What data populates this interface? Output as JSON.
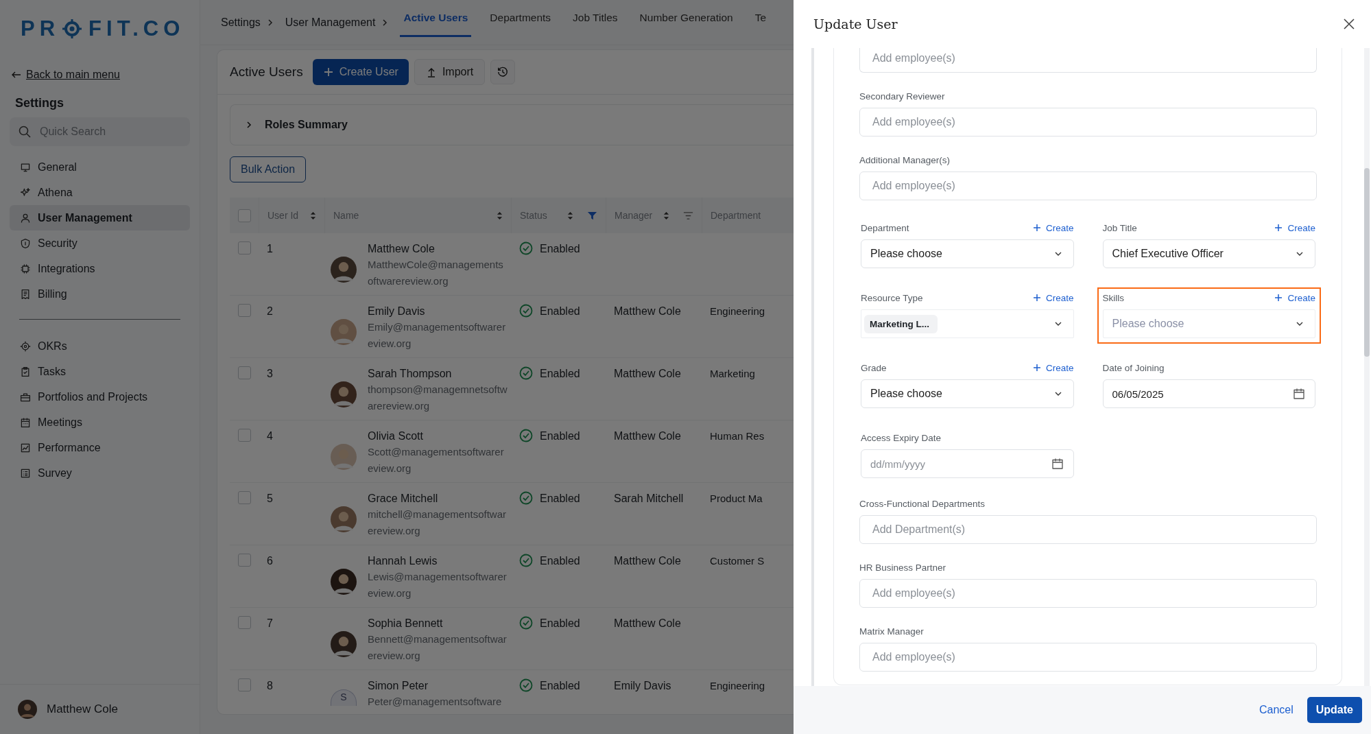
{
  "sidebar": {
    "logo": [
      "PR",
      "FIT.CO"
    ],
    "back_link": "Back to main menu",
    "heading": "Settings",
    "search": {
      "placeholder": "Quick Search"
    },
    "groups": [
      {
        "items": [
          {
            "label": "General",
            "selected": false
          },
          {
            "label": "Athena",
            "selected": false
          },
          {
            "label": "User Management",
            "selected": true
          },
          {
            "label": "Security",
            "selected": false
          },
          {
            "label": "Integrations",
            "selected": false
          },
          {
            "label": "Billing",
            "selected": false
          }
        ]
      },
      {
        "items": [
          {
            "label": "OKRs",
            "selected": false
          },
          {
            "label": "Tasks",
            "selected": false
          },
          {
            "label": "Portfolios and Projects",
            "selected": false
          },
          {
            "label": "Meetings",
            "selected": false
          },
          {
            "label": "Performance",
            "selected": false
          },
          {
            "label": "Survey",
            "selected": false
          }
        ]
      }
    ],
    "user": {
      "name": "Matthew Cole"
    }
  },
  "breadcrumbs": [
    "Settings",
    "User Management"
  ],
  "tabs": [
    {
      "label": "Active Users",
      "selected": true
    },
    {
      "label": "Departments",
      "selected": false
    },
    {
      "label": "Job Titles",
      "selected": false
    },
    {
      "label": "Number Generation",
      "selected": false
    },
    {
      "label": "Te",
      "selected": false
    }
  ],
  "toolbar": {
    "title": "Active Users",
    "create_button": "Create User",
    "import_button": "Import"
  },
  "roles_summary": {
    "label": "Roles Summary",
    "expanded": false
  },
  "bulk_action": "Bulk Action",
  "table": {
    "header_checked": false,
    "columns": [
      {
        "label": "User Id",
        "sortable": true
      },
      {
        "label": "Name",
        "sortable": true
      },
      {
        "label": "Status",
        "sortable": true,
        "filter_active": true
      },
      {
        "label": "Manager",
        "sortable": true,
        "filter_active": false
      },
      {
        "label": "Department",
        "sortable": false
      }
    ],
    "rows": [
      {
        "checked": false,
        "id": "1",
        "name": "Matthew Cole",
        "email": "MatthewCole@managementsoftwarereview.org",
        "avatar": {
          "kind": "photo"
        },
        "status": "Enabled",
        "manager": "",
        "department": ""
      },
      {
        "checked": false,
        "id": "2",
        "name": "Emily Davis",
        "email": "Emily@managementsoftwarereview.org",
        "avatar": {
          "kind": "photo"
        },
        "status": "Enabled",
        "manager": "Matthew Cole",
        "department": "Engineering"
      },
      {
        "checked": false,
        "id": "3",
        "name": "Sarah Thompson",
        "email": "thompson@managemnetsoftwarereview.org",
        "avatar": {
          "kind": "photo"
        },
        "status": "Enabled",
        "manager": "Matthew Cole",
        "department": "Marketing"
      },
      {
        "checked": false,
        "id": "4",
        "name": "Olivia Scott",
        "email": "Scott@managementsoftwarereview.org",
        "avatar": {
          "kind": "photo"
        },
        "status": "Enabled",
        "manager": "Matthew Cole",
        "department": "Human Res"
      },
      {
        "checked": false,
        "id": "5",
        "name": "Grace Mitchell",
        "email": "mitchell@managementsoftwarereview.org",
        "avatar": {
          "kind": "photo"
        },
        "status": "Enabled",
        "manager": "Sarah Mitchell",
        "department": "Product Ma"
      },
      {
        "checked": false,
        "id": "6",
        "name": "Hannah Lewis",
        "email": "Lewis@managementsoftwarereview.org",
        "avatar": {
          "kind": "photo"
        },
        "status": "Enabled",
        "manager": "Matthew Cole",
        "department": "Customer S"
      },
      {
        "checked": false,
        "id": "7",
        "name": "Sophia Bennett",
        "email": "Bennett@managementsoftwarereview.org",
        "avatar": {
          "kind": "photo"
        },
        "status": "Enabled",
        "manager": "Matthew Cole",
        "department": ""
      },
      {
        "checked": false,
        "id": "8",
        "name": "Simon Peter",
        "email": "Peter@managementsoftware",
        "avatar": {
          "kind": "initial",
          "initial": "S"
        },
        "status": "Enabled",
        "manager": "Emily Davis",
        "department": "Engineering"
      }
    ]
  },
  "panel": {
    "title": "Update User",
    "rows": [
      [
        {
          "kind": "employees",
          "placeholder": "Add employee(s)",
          "partly_hidden": true
        }
      ],
      [
        {
          "kind": "employees",
          "label": "Secondary Reviewer",
          "placeholder": "Add employee(s)"
        }
      ],
      [
        {
          "kind": "employees",
          "label": "Additional Manager(s)",
          "placeholder": "Add employee(s)"
        }
      ],
      [
        {
          "kind": "select",
          "label": "Department",
          "create": "Create",
          "value": "Please choose",
          "highlighted": false
        },
        {
          "kind": "select",
          "label": "Job Title",
          "create": "Create",
          "value": "Chief Executive Officer",
          "highlighted": false
        }
      ],
      [
        {
          "kind": "tag-select",
          "label": "Resource Type",
          "create": "Create",
          "tag": "Marketing L...",
          "highlighted": false
        },
        {
          "kind": "select",
          "label": "Skills",
          "create": "Create",
          "placeholder": "Please choose",
          "highlighted": true
        }
      ],
      [
        {
          "kind": "select",
          "label": "Grade",
          "create": "Create",
          "value": "Please choose",
          "highlighted": false
        },
        {
          "kind": "date",
          "label": "Date of Joining",
          "value": "06/05/2025",
          "highlighted": false
        }
      ],
      [
        {
          "kind": "date",
          "label": "Access Expiry Date",
          "placeholder": "dd/mm/yyyy",
          "highlighted": false
        },
        {
          "kind": "empty"
        }
      ],
      [
        {
          "kind": "employees",
          "label": "Cross-Functional Departments",
          "placeholder": "Add Department(s)"
        }
      ],
      [
        {
          "kind": "employees",
          "label": "HR Business Partner",
          "placeholder": "Add employee(s)"
        }
      ],
      [
        {
          "kind": "employees",
          "label": "Matrix Manager",
          "placeholder": "Add employee(s)"
        }
      ]
    ],
    "cancel_button": "Cancel",
    "update_button": "Update"
  }
}
